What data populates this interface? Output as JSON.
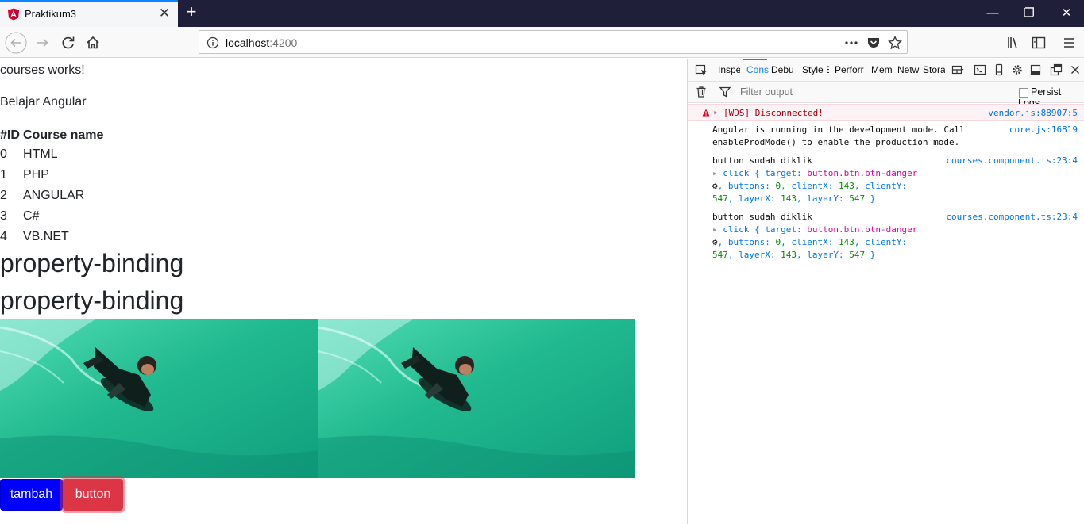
{
  "browser": {
    "tab_title": "Praktikum3",
    "tab_close": "✕",
    "new_tab": "+",
    "url_host": "localhost",
    "url_port": ":4200",
    "window_minimize": "—",
    "window_restore": "❐",
    "window_close": "✕"
  },
  "page": {
    "intro": "courses works!",
    "subtitle": "Belajar Angular",
    "table": {
      "headers": [
        "#ID",
        "Course name"
      ],
      "rows": [
        [
          "0",
          "HTML"
        ],
        [
          "1",
          "PHP"
        ],
        [
          "2",
          "ANGULAR"
        ],
        [
          "3",
          "C#"
        ],
        [
          "4",
          "VB.NET"
        ]
      ]
    },
    "heading_1": "property-binding",
    "heading_2": "property-binding",
    "buttons": {
      "add": "tambah",
      "danger": "button"
    }
  },
  "devtools": {
    "tabs": [
      "Inspe",
      "Cons",
      "Debu",
      "Style E",
      "Perforr",
      "Mem",
      "Netw",
      "Stora"
    ],
    "active_tab": "Cons",
    "filter_placeholder": "Filter output",
    "persist_logs": "Persist Logs",
    "messages": {
      "wds": {
        "text": "[WDS] Disconnected!",
        "source": "vendor.js:88907:5"
      },
      "angular": {
        "line1": "Angular is running in the development mode. Call",
        "line2": "enableProdMode() to enable the production mode.",
        "source": "core.js:16819"
      },
      "click1": {
        "title": "button sudah diklik",
        "source": "courses.component.ts:23:4",
        "event": "click",
        "target_key": "target:",
        "target_val": "button.btn.btn-danger",
        "buttons_key": "buttons:",
        "buttons_val": "0",
        "clientx_key": "clientX:",
        "clientx_val": "143",
        "clienty_key": "clientY:",
        "clienty_val": "547",
        "layerx_key": "layerX:",
        "layerx_val": "143",
        "layery_key": "layerY:",
        "layery_val": "547"
      },
      "click2": {
        "title": "button sudah diklik",
        "source": "courses.component.ts:23:4",
        "event": "click",
        "target_key": "target:",
        "target_val": "button.btn.btn-danger",
        "buttons_key": "buttons:",
        "buttons_val": "0",
        "clientx_key": "clientX:",
        "clientx_val": "143",
        "clienty_key": "clientY:",
        "clienty_val": "547",
        "layerx_key": "layerX:",
        "layerx_val": "143",
        "layery_key": "layerY:",
        "layery_val": "547"
      }
    }
  },
  "colors": {
    "tabbar": "#1f1f3a",
    "tab_accent": "#0a84ff",
    "btn_primary": "#0000ff",
    "btn_danger": "#dc3545"
  }
}
